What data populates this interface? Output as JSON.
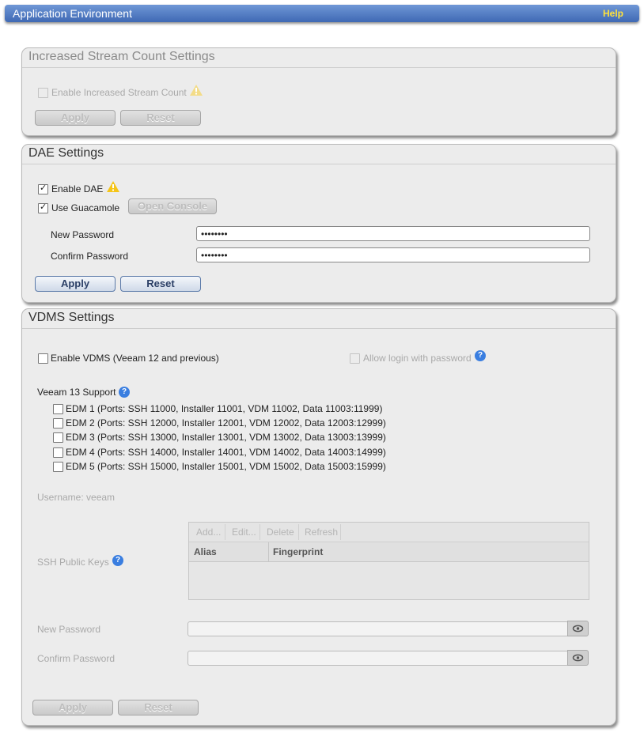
{
  "header": {
    "title": "Application Environment",
    "help": "Help"
  },
  "stream": {
    "title": "Increased Stream Count Settings",
    "enable_label": "Enable Increased Stream Count",
    "enable_checked": false,
    "apply": "Apply",
    "reset": "Reset"
  },
  "dae": {
    "title": "DAE Settings",
    "enable_label": "Enable DAE",
    "enable_checked": true,
    "guac_label": "Use Guacamole",
    "guac_checked": true,
    "open_console": "Open Console",
    "new_password_label": "New Password",
    "new_password_value": "••••••••",
    "confirm_password_label": "Confirm Password",
    "confirm_password_value": "••••••••",
    "apply": "Apply",
    "reset": "Reset"
  },
  "vdms": {
    "title": "VDMS Settings",
    "enable_label": "Enable VDMS (Veeam 12 and previous)",
    "allow_login_label": "Allow login with password",
    "veeam13_label": "Veeam 13 Support",
    "edm": [
      "EDM 1 (Ports: SSH 11000, Installer 11001, VDM 11002, Data 11003:11999)",
      "EDM 2 (Ports: SSH 12000, Installer 12001, VDM 12002, Data 12003:12999)",
      "EDM 3 (Ports: SSH 13000, Installer 13001, VDM 13002, Data 13003:13999)",
      "EDM 4 (Ports: SSH 14000, Installer 14001, VDM 14002, Data 14003:14999)",
      "EDM 5 (Ports: SSH 15000, Installer 15001, VDM 15002, Data 15003:15999)"
    ],
    "username": "Username: veeam",
    "ssh_keys_label": "SSH Public Keys",
    "grid": {
      "add": "Add...",
      "edit": "Edit...",
      "delete": "Delete",
      "refresh": "Refresh",
      "col_alias": "Alias",
      "col_fingerprint": "Fingerprint"
    },
    "new_password_label": "New Password",
    "confirm_password_label": "Confirm Password",
    "apply": "Apply",
    "reset": "Reset"
  },
  "icons": {
    "warning": "warning-icon",
    "help": "question-icon",
    "eye": "eye-icon",
    "accent": "#3f69b4",
    "warning_color": "#f5c518"
  }
}
